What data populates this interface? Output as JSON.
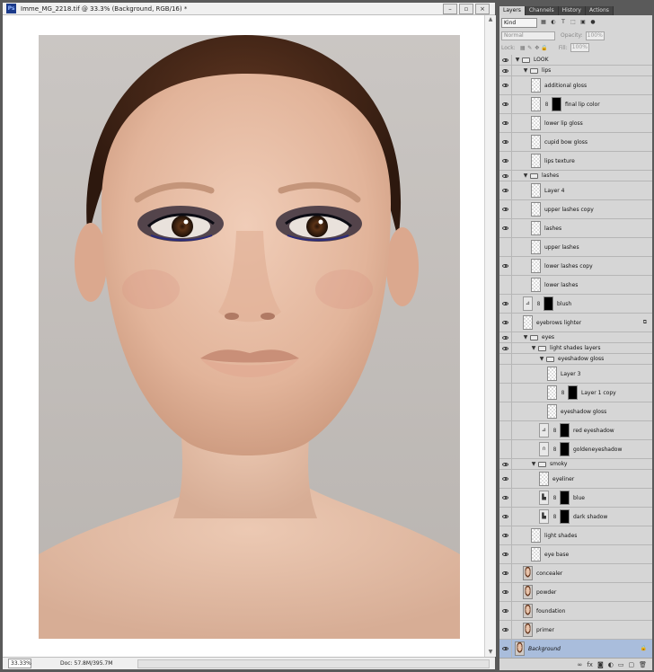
{
  "document": {
    "title": "Imme_MG_2218.tif @ 33.3% (Background, RGB/16) *",
    "app_badge": "Ps",
    "window_buttons": [
      "–",
      "▫",
      "×"
    ],
    "zoom": "33.33%",
    "doc_info": "Doc: 57.8M/395.7M"
  },
  "panel": {
    "tabs": [
      "Layers",
      "Channels",
      "History",
      "Actions"
    ],
    "active_tab": "Layers",
    "filter_kind": "Kind",
    "blend_mode": "Normal",
    "opacity_label": "Opacity:",
    "opacity_value": "100%",
    "lock_label": "Lock:",
    "fill_label": "Fill:",
    "fill_value": "100%",
    "bottom_icons": [
      "link-icon",
      "fx-icon",
      "mask-icon",
      "adjustment-icon",
      "group-icon",
      "new-layer-icon",
      "trash-icon"
    ]
  },
  "layers": [
    {
      "name": "LOOK",
      "type": "group",
      "indent": 0,
      "visible": true,
      "expanded": true
    },
    {
      "name": "lips",
      "type": "group",
      "indent": 1,
      "visible": true,
      "expanded": true
    },
    {
      "name": "additional gloss",
      "type": "layer",
      "indent": 2,
      "visible": true,
      "thumb": "transparent"
    },
    {
      "name": "final lip color",
      "type": "layer",
      "indent": 2,
      "visible": true,
      "thumb": "transparent",
      "mask": true
    },
    {
      "name": "lower lip gloss",
      "type": "layer",
      "indent": 2,
      "visible": true,
      "thumb": "transparent"
    },
    {
      "name": "cupid bow gloss",
      "type": "layer",
      "indent": 2,
      "visible": true,
      "thumb": "transparent"
    },
    {
      "name": "lips texture",
      "type": "layer",
      "indent": 2,
      "visible": true,
      "thumb": "transparent"
    },
    {
      "name": "lashes",
      "type": "group",
      "indent": 1,
      "visible": true,
      "expanded": true
    },
    {
      "name": "Layer 4",
      "type": "layer",
      "indent": 2,
      "visible": true,
      "thumb": "transparent"
    },
    {
      "name": "upper lashes copy",
      "type": "layer",
      "indent": 2,
      "visible": true,
      "thumb": "transparent"
    },
    {
      "name": "lashes",
      "type": "layer",
      "indent": 2,
      "visible": true,
      "thumb": "transparent"
    },
    {
      "name": "upper lashes",
      "type": "layer",
      "indent": 2,
      "visible": false,
      "thumb": "transparent"
    },
    {
      "name": "lower lashes copy",
      "type": "layer",
      "indent": 2,
      "visible": true,
      "thumb": "transparent"
    },
    {
      "name": "lower lashes",
      "type": "layer",
      "indent": 2,
      "visible": false,
      "thumb": "transparent"
    },
    {
      "name": "blush",
      "type": "adjustment",
      "indent": 1,
      "visible": true,
      "adj": "⊿",
      "mask": true
    },
    {
      "name": "eyebrows lighter",
      "type": "layer",
      "indent": 1,
      "visible": true,
      "thumb": "transparent",
      "badge": "⧉"
    },
    {
      "name": "eyes",
      "type": "group",
      "indent": 1,
      "visible": true,
      "expanded": true
    },
    {
      "name": "light shades layers",
      "type": "group",
      "indent": 2,
      "visible": true,
      "expanded": true
    },
    {
      "name": "eyeshadow gloss",
      "type": "group",
      "indent": 3,
      "visible": false,
      "expanded": true
    },
    {
      "name": "Layer 3",
      "type": "layer",
      "indent": 4,
      "visible": false,
      "thumb": "transparent"
    },
    {
      "name": "Layer 1 copy",
      "type": "layer",
      "indent": 4,
      "visible": false,
      "thumb": "transparent",
      "mask": true
    },
    {
      "name": "eyeshadow gloss",
      "type": "layer",
      "indent": 4,
      "visible": false,
      "thumb": "transparent"
    },
    {
      "name": "red eyeshadow",
      "type": "adjustment",
      "indent": 3,
      "visible": false,
      "adj": "⊿",
      "mask": true
    },
    {
      "name": "goldeneyeshadow",
      "type": "adjustment",
      "indent": 3,
      "visible": false,
      "adj": "∩",
      "mask": true
    },
    {
      "name": "smoky",
      "type": "group",
      "indent": 2,
      "visible": true,
      "expanded": true
    },
    {
      "name": "eyeliner",
      "type": "layer",
      "indent": 3,
      "visible": true,
      "thumb": "transparent"
    },
    {
      "name": "blue",
      "type": "adjustment",
      "indent": 3,
      "visible": true,
      "adj": "▙",
      "mask": true
    },
    {
      "name": "dark shadow",
      "type": "adjustment",
      "indent": 3,
      "visible": true,
      "adj": "▙",
      "mask": true
    },
    {
      "name": "light shades",
      "type": "layer",
      "indent": 2,
      "visible": true,
      "thumb": "transparent"
    },
    {
      "name": "eye base",
      "type": "layer",
      "indent": 2,
      "visible": true,
      "thumb": "transparent"
    },
    {
      "name": "concealer",
      "type": "layer",
      "indent": 1,
      "visible": true,
      "thumb": "face"
    },
    {
      "name": "powder",
      "type": "layer",
      "indent": 1,
      "visible": true,
      "thumb": "face"
    },
    {
      "name": "foundation",
      "type": "layer",
      "indent": 1,
      "visible": true,
      "thumb": "face"
    },
    {
      "name": "primer",
      "type": "layer",
      "indent": 1,
      "visible": true,
      "thumb": "face"
    },
    {
      "name": "Background",
      "type": "layer",
      "indent": 0,
      "visible": true,
      "thumb": "face",
      "selected": true,
      "italic": true,
      "badge": "🔒"
    }
  ]
}
